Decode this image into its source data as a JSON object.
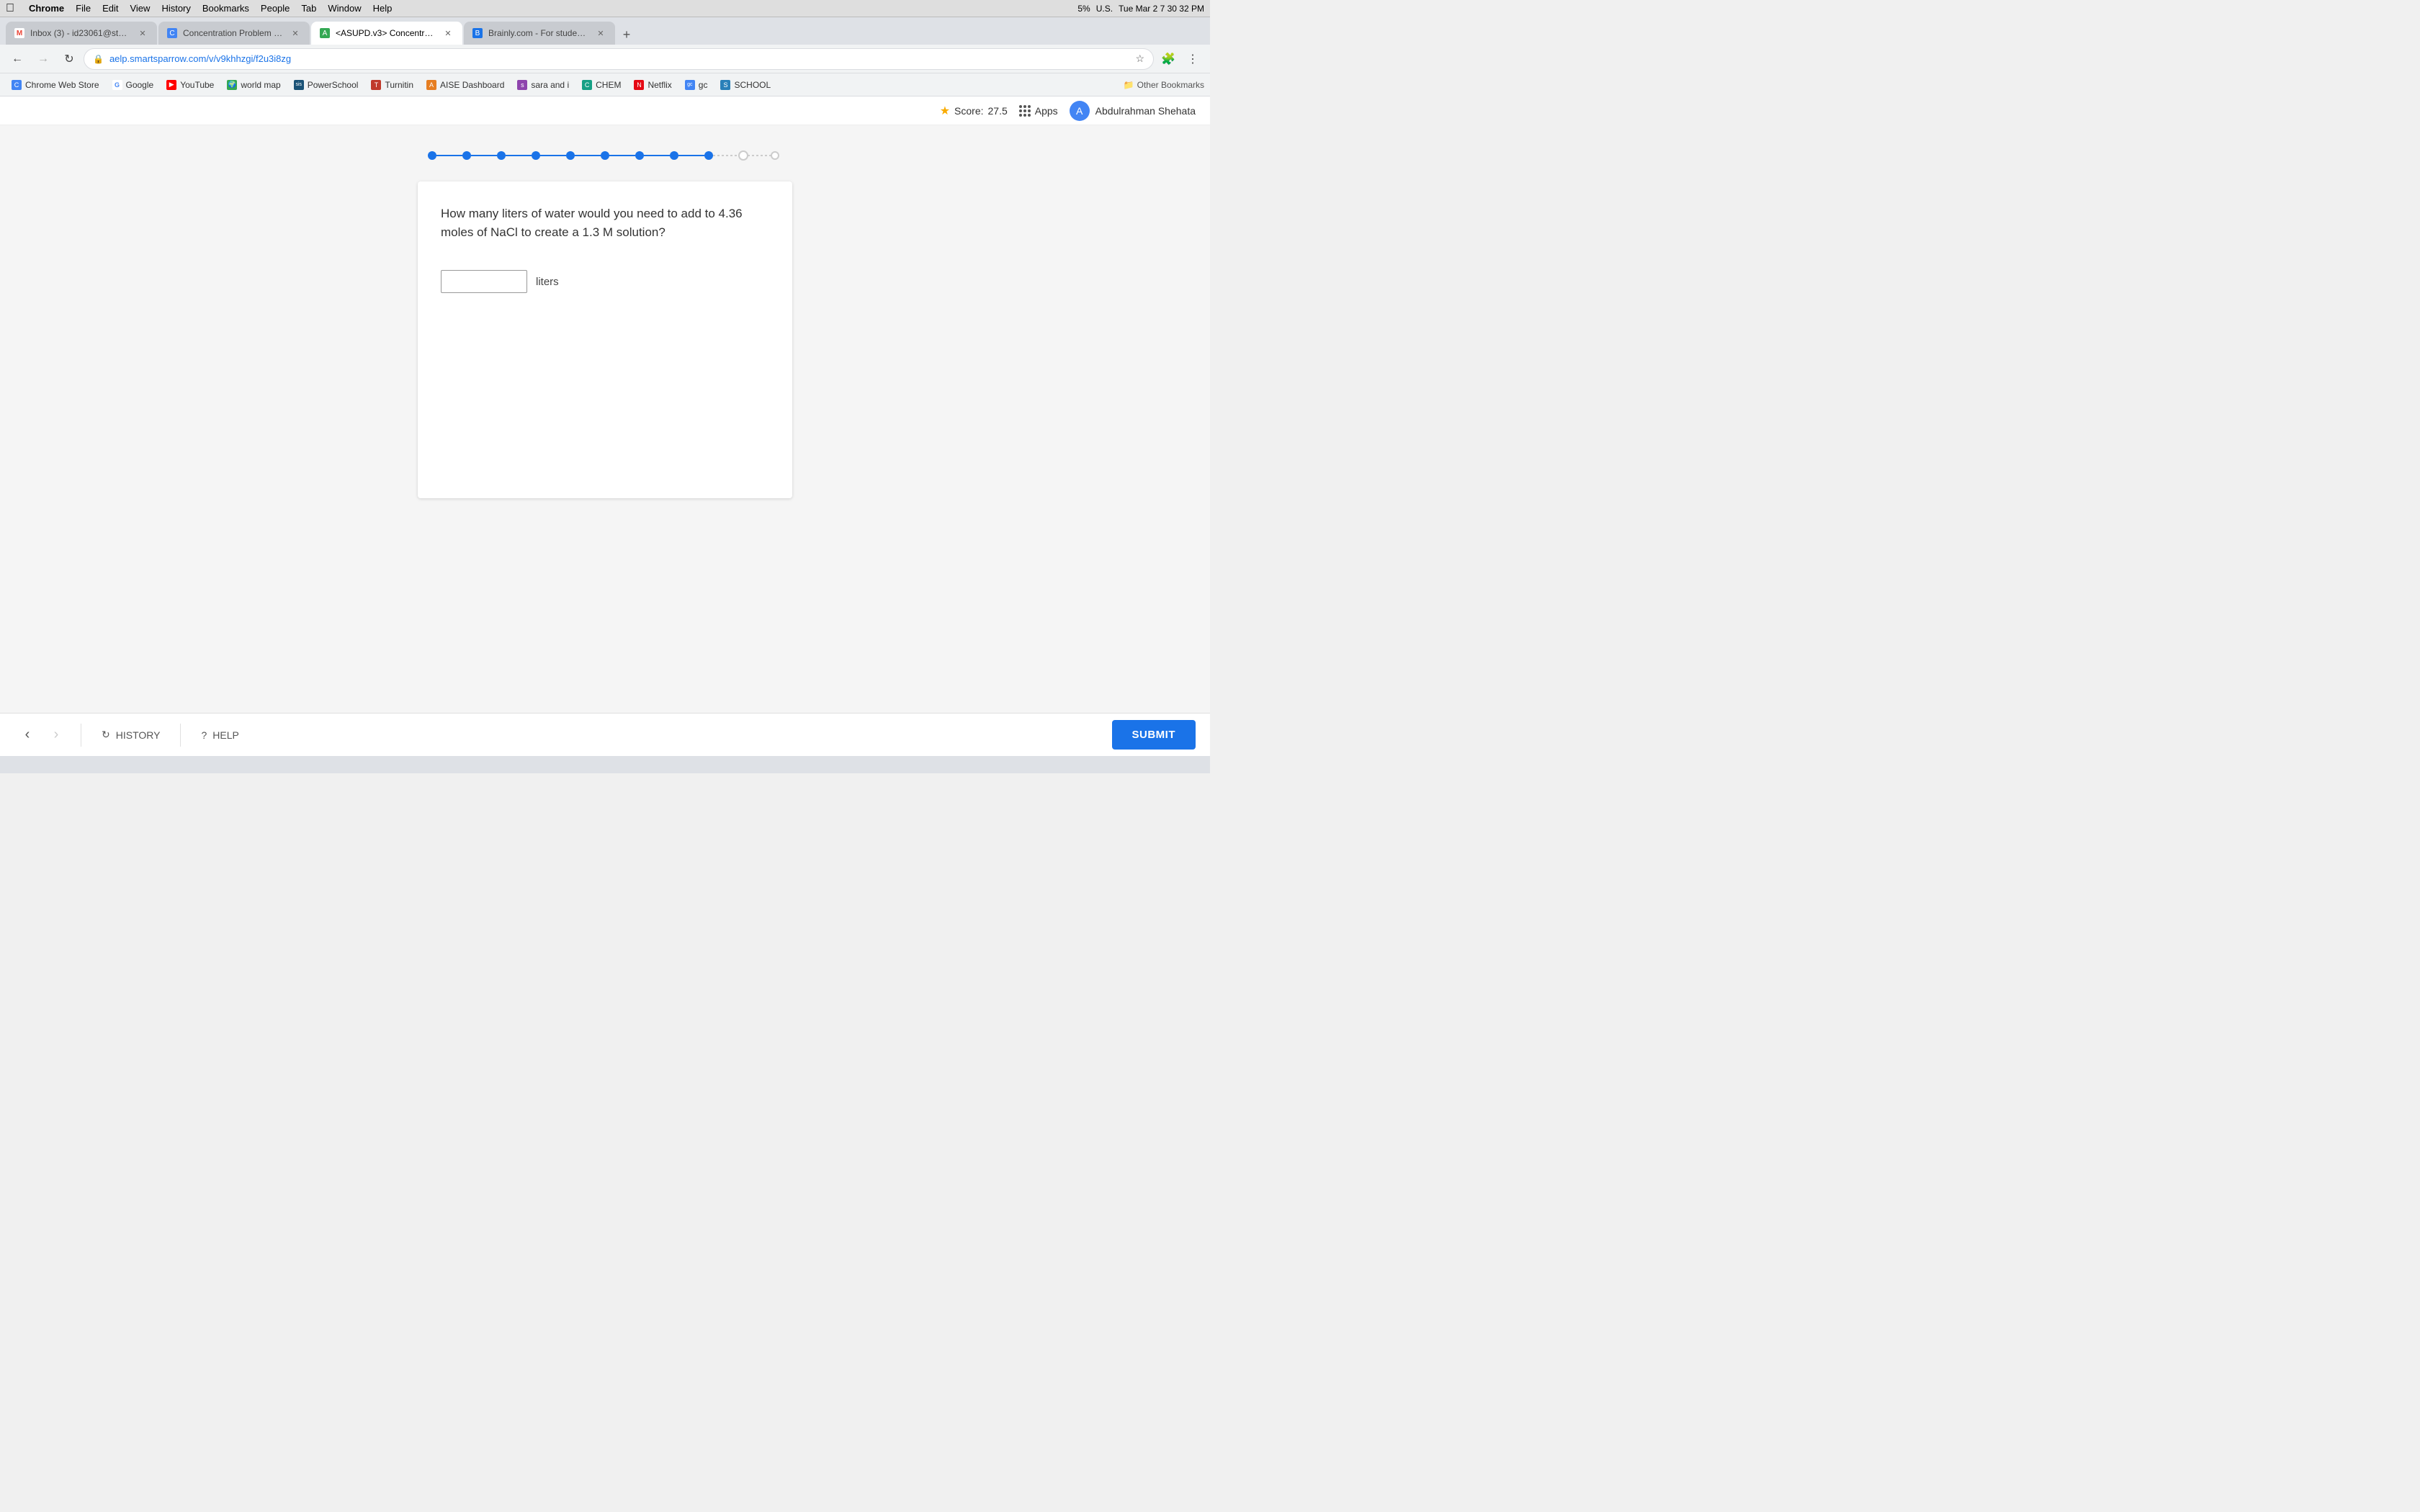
{
  "menu_bar": {
    "apple": "⌘",
    "items": [
      "Chrome",
      "File",
      "Edit",
      "View",
      "History",
      "Bookmarks",
      "People",
      "Tab",
      "Window",
      "Help"
    ],
    "right": {
      "time": "Tue Mar 2  7 30 32 PM",
      "battery": "5%",
      "locale": "U.S."
    }
  },
  "tabs": [
    {
      "id": "gmail",
      "label": "Inbox (3) - id23061@stu.aise...",
      "active": false,
      "favicon_class": "fav-gmail",
      "favicon_text": "M"
    },
    {
      "id": "concentration",
      "label": "Concentration Problem Set",
      "active": false,
      "favicon_class": "fav-concentration",
      "favicon_text": "C"
    },
    {
      "id": "asupd",
      "label": "<ASUPD.v3> Concentration P...",
      "active": true,
      "favicon_class": "fav-asupd",
      "favicon_text": "A"
    },
    {
      "id": "brainly",
      "label": "Brainly.com - For students. By...",
      "active": false,
      "favicon_class": "fav-brainly",
      "favicon_text": "B"
    }
  ],
  "nav": {
    "url": "aelp.smartsparrow.com/v/v9khhzgi/f2u3i8zg",
    "back_disabled": false,
    "forward_disabled": true
  },
  "bookmarks": [
    {
      "id": "chrome-web-store",
      "label": "Chrome Web Store",
      "favicon_class": "fav-chrome",
      "favicon_text": "C"
    },
    {
      "id": "google",
      "label": "Google",
      "favicon_class": "fav-google",
      "favicon_text": "G"
    },
    {
      "id": "youtube",
      "label": "YouTube",
      "favicon_class": "fav-youtube",
      "favicon_text": "▶"
    },
    {
      "id": "world-map",
      "label": "world map",
      "favicon_class": "fav-world",
      "favicon_text": "🌍"
    },
    {
      "id": "powerschool",
      "label": "PowerSchool",
      "favicon_class": "fav-power",
      "favicon_text": "PS"
    },
    {
      "id": "turnitin",
      "label": "Turnitin",
      "favicon_class": "fav-turnitin",
      "favicon_text": "T"
    },
    {
      "id": "aise",
      "label": "AISE Dashboard",
      "favicon_class": "fav-aise",
      "favicon_text": "A"
    },
    {
      "id": "sara",
      "label": "sara and i",
      "favicon_class": "fav-sara",
      "favicon_text": "s"
    },
    {
      "id": "chem",
      "label": "CHEM",
      "favicon_class": "fav-chem",
      "favicon_text": "C"
    },
    {
      "id": "netflix",
      "label": "Netflix",
      "favicon_class": "fav-netflix",
      "favicon_text": "N"
    },
    {
      "id": "gc",
      "label": "gc",
      "favicon_class": "fav-gc",
      "favicon_text": "gc"
    },
    {
      "id": "school",
      "label": "SCHOOL",
      "favicon_class": "fav-school",
      "favicon_text": "S"
    }
  ],
  "app_bar": {
    "score_label": "Score:",
    "score_value": "27.5",
    "apps_label": "Apps",
    "user_name": "Abdulrahman Shehata",
    "user_initial": "A"
  },
  "progress": {
    "total_dots": 12,
    "filled_dots": 9
  },
  "question": {
    "text": "How many liters of water would you need to add to 4.36 moles of NaCl to create a 1.3 M solution?",
    "input_placeholder": "",
    "unit": "liters"
  },
  "bottom_nav": {
    "history_label": "HISTORY",
    "help_label": "HELP",
    "submit_label": "SUBMIT"
  }
}
